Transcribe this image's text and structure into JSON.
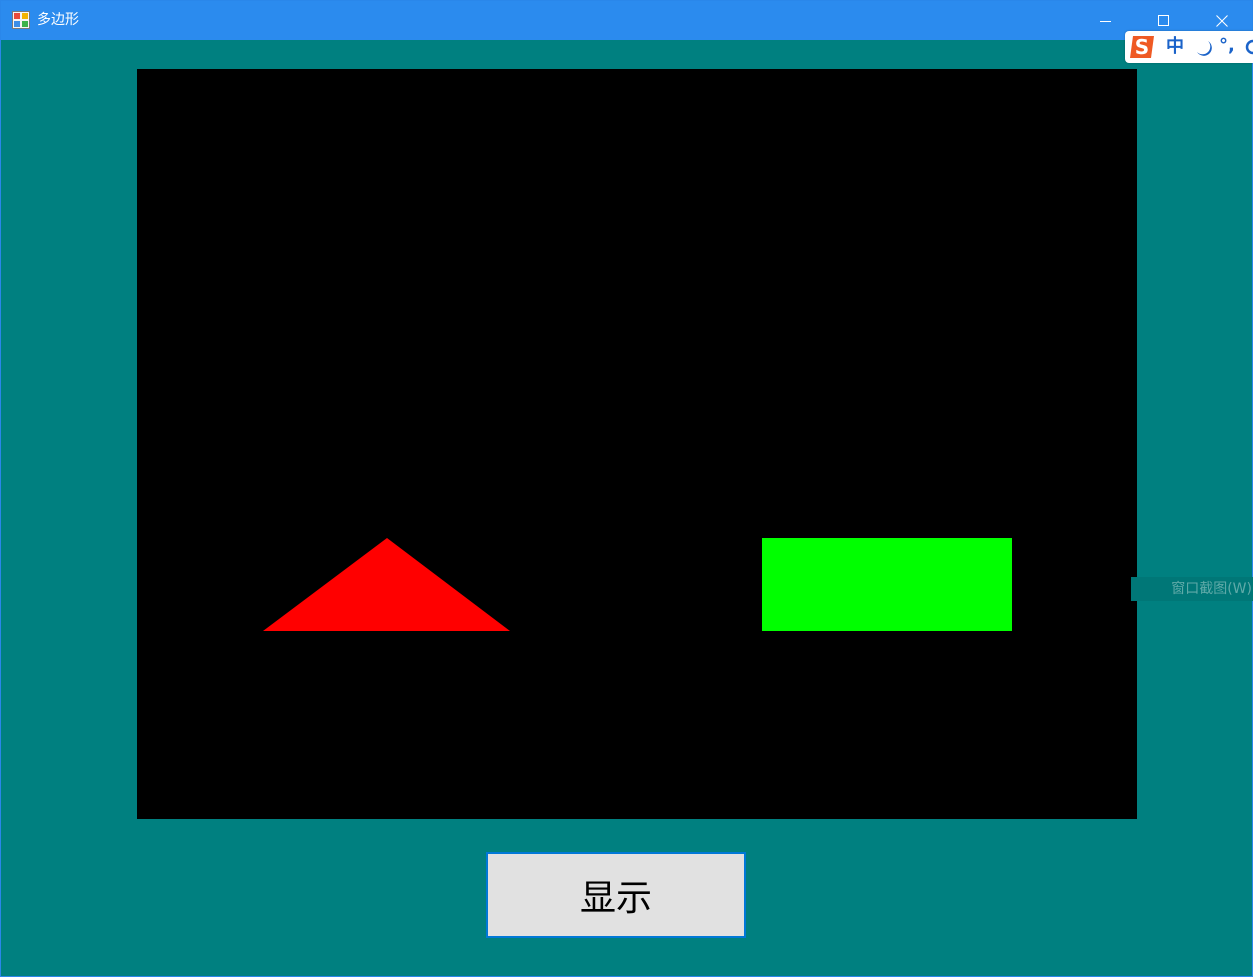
{
  "window": {
    "title": "多边形",
    "app_icon": "winforms-app-icon",
    "controls": {
      "minimize_icon": "minimize-icon",
      "maximize_icon": "maximize-icon",
      "close_icon": "close-icon"
    },
    "background_color": "#008080",
    "titlebar_color": "#2b8bee"
  },
  "ime_toolbar": {
    "logo_icon": "sogou-s-icon",
    "mode_label": "中",
    "moon_icon": "half-width-moon-icon",
    "punctuation_label": "°,",
    "more_icon": "settings-circle-icon"
  },
  "canvas": {
    "background_color": "#000000",
    "shapes": [
      {
        "type": "triangle",
        "name": "red-triangle",
        "color": "#ff0000"
      },
      {
        "type": "rectangle",
        "name": "green-rectangle",
        "color": "#00ff00"
      }
    ]
  },
  "tooltip": {
    "text": "窗口截图(W)"
  },
  "show_button": {
    "label": "显示"
  }
}
